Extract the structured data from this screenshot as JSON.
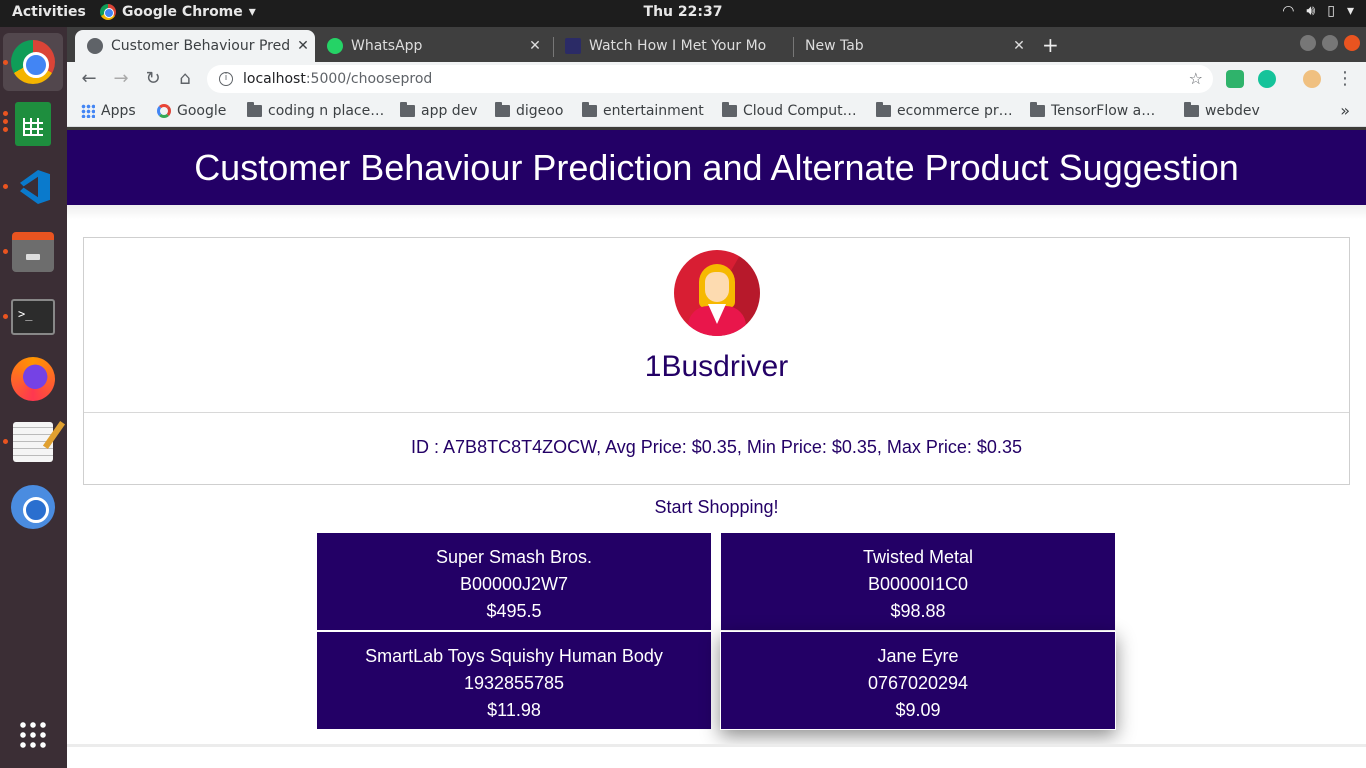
{
  "system": {
    "activities": "Activities",
    "app_menu": "Google Chrome",
    "clock": "Thu 22:37",
    "tray_icons": [
      "wifi-icon",
      "volume-icon",
      "battery-icon",
      "power-menu-icon"
    ]
  },
  "dock": {
    "items": [
      "chrome",
      "libreoffice-calc",
      "vscode",
      "files",
      "terminal",
      "firefox",
      "text-editor",
      "chromium",
      "show-applications"
    ]
  },
  "browser": {
    "tabs": [
      {
        "title": "Customer Behaviour Pred",
        "active": true
      },
      {
        "title": "WhatsApp",
        "active": false
      },
      {
        "title": "Watch How I Met Your Mo",
        "active": false
      },
      {
        "title": "New Tab",
        "active": false
      }
    ],
    "url_host": "localhost",
    "url_path": ":5000/chooseprod",
    "bookmarks": [
      "Apps",
      "Google",
      "coding n place…",
      "app dev",
      "digeoo",
      "entertainment",
      "Cloud Comput…",
      "ecommerce pr…",
      "TensorFlow a…",
      "webdev"
    ]
  },
  "page": {
    "banner_title": "Customer Behaviour Prediction and Alternate Product Suggestion",
    "username": "1Busdriver",
    "details": "ID : A7B8TC8T4ZOCW, Avg Price: $0.35, Min Price: $0.35, Max Price: $0.35",
    "start_label": "Start Shopping!",
    "products": [
      {
        "name": "Super Smash Bros.",
        "id": "B00000J2W7",
        "price": "$495.5"
      },
      {
        "name": "Twisted Metal",
        "id": "B00000I1C0",
        "price": "$98.88"
      },
      {
        "name": "SmartLab Toys Squishy Human Body",
        "id": "1932855785",
        "price": "$11.98"
      },
      {
        "name": "Jane Eyre",
        "id": "0767020294",
        "price": "$9.09"
      }
    ]
  },
  "colors": {
    "brand": "#230066",
    "ubuntu_orange": "#e95420"
  }
}
